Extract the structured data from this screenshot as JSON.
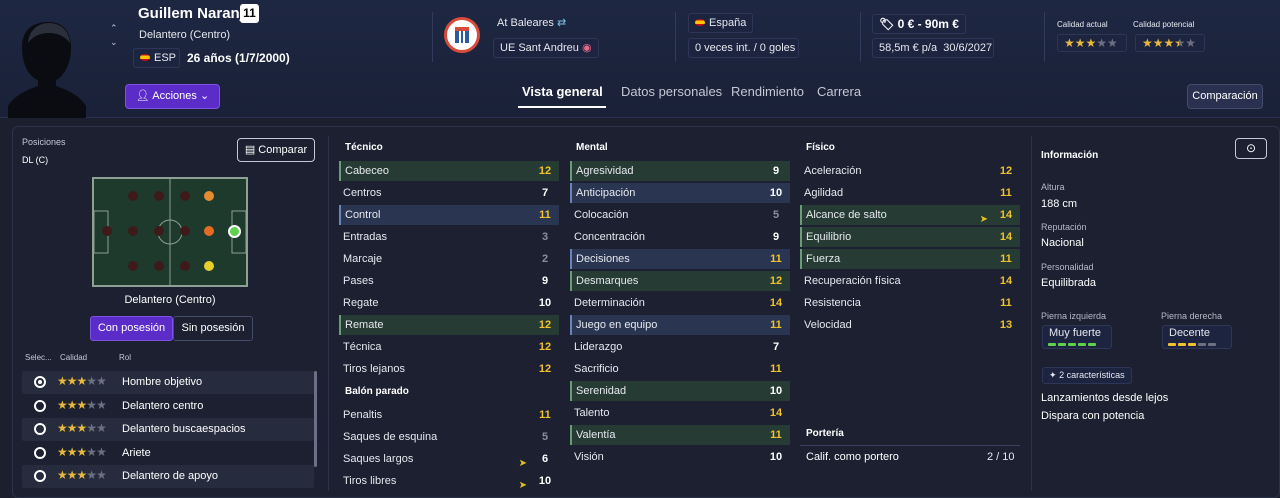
{
  "player": {
    "name": "Guillem Naranjo",
    "number": "11",
    "position": "Delantero (Centro)",
    "nation_code": "ESP",
    "age": "26 años (1/7/2000)"
  },
  "header": {
    "actions_label": "Acciones",
    "club_loan": "At Baleares",
    "club_own": "UE Sant Andreu",
    "nation": "España",
    "intl": "0 veces int. / 0 goles",
    "value": "0 € - 90m €",
    "contract": "58,5m € p/a",
    "contract_date": "30/6/2027",
    "current_quality_label": "Calidad actual",
    "potential_quality_label": "Calidad potencial",
    "current_stars": 3,
    "potential_stars": 3.5
  },
  "tabs": [
    "Vista general",
    "Datos personales",
    "Rendimiento",
    "Carrera"
  ],
  "compare_label": "Comparación",
  "left": {
    "positions_label": "Posiciones",
    "positions_value": "DL (C)",
    "compare_btn": "Comparar",
    "pitch_label": "Delantero (Centro)",
    "toggle_on": "Con posesión",
    "toggle_off": "Sin posesión",
    "cols": [
      "Selec...",
      "Calidad",
      "Rol"
    ],
    "roles": [
      {
        "name": "Hombre objetivo",
        "stars": 3,
        "selected": true
      },
      {
        "name": "Delantero centro",
        "stars": 3,
        "selected": false
      },
      {
        "name": "Delantero buscaespacios",
        "stars": 3,
        "selected": false
      },
      {
        "name": "Ariete",
        "stars": 3,
        "selected": false
      },
      {
        "name": "Delantero de apoyo",
        "stars": 3,
        "selected": false
      }
    ]
  },
  "tecnico": {
    "title": "Técnico",
    "attrs": [
      {
        "n": "Cabeceo",
        "v": "12",
        "c": "y",
        "h": "g"
      },
      {
        "n": "Centros",
        "v": "7",
        "c": "w",
        "h": ""
      },
      {
        "n": "Control",
        "v": "11",
        "c": "y",
        "h": "b"
      },
      {
        "n": "Entradas",
        "v": "3",
        "c": "g",
        "h": ""
      },
      {
        "n": "Marcaje",
        "v": "2",
        "c": "g",
        "h": ""
      },
      {
        "n": "Pases",
        "v": "9",
        "c": "w",
        "h": ""
      },
      {
        "n": "Regate",
        "v": "10",
        "c": "w",
        "h": ""
      },
      {
        "n": "Remate",
        "v": "12",
        "c": "y",
        "h": "g"
      },
      {
        "n": "Técnica",
        "v": "12",
        "c": "y",
        "h": ""
      },
      {
        "n": "Tiros lejanos",
        "v": "12",
        "c": "y",
        "h": ""
      }
    ]
  },
  "balon": {
    "title": "Balón parado",
    "attrs": [
      {
        "n": "Penaltis",
        "v": "11",
        "c": "y",
        "h": ""
      },
      {
        "n": "Saques de esquina",
        "v": "5",
        "c": "g",
        "h": ""
      },
      {
        "n": "Saques largos",
        "v": "6",
        "c": "w",
        "h": "",
        "arrow": true
      },
      {
        "n": "Tiros libres",
        "v": "10",
        "c": "w",
        "h": "",
        "arrow": true
      }
    ]
  },
  "mental": {
    "title": "Mental",
    "attrs": [
      {
        "n": "Agresividad",
        "v": "9",
        "c": "w",
        "h": "g"
      },
      {
        "n": "Anticipación",
        "v": "10",
        "c": "w",
        "h": "b"
      },
      {
        "n": "Colocación",
        "v": "5",
        "c": "g",
        "h": ""
      },
      {
        "n": "Concentración",
        "v": "9",
        "c": "w",
        "h": ""
      },
      {
        "n": "Decisiones",
        "v": "11",
        "c": "y",
        "h": "b"
      },
      {
        "n": "Desmarques",
        "v": "12",
        "c": "y",
        "h": "g"
      },
      {
        "n": "Determinación",
        "v": "14",
        "c": "y",
        "h": ""
      },
      {
        "n": "Juego en equipo",
        "v": "11",
        "c": "y",
        "h": "b"
      },
      {
        "n": "Liderazgo",
        "v": "7",
        "c": "w",
        "h": ""
      },
      {
        "n": "Sacrificio",
        "v": "11",
        "c": "y",
        "h": ""
      },
      {
        "n": "Serenidad",
        "v": "10",
        "c": "w",
        "h": "g"
      },
      {
        "n": "Talento",
        "v": "14",
        "c": "y",
        "h": ""
      },
      {
        "n": "Valentía",
        "v": "11",
        "c": "y",
        "h": "g"
      },
      {
        "n": "Visión",
        "v": "10",
        "c": "w",
        "h": ""
      }
    ]
  },
  "fisico": {
    "title": "Físico",
    "attrs": [
      {
        "n": "Aceleración",
        "v": "12",
        "c": "y",
        "h": ""
      },
      {
        "n": "Agilidad",
        "v": "11",
        "c": "y",
        "h": ""
      },
      {
        "n": "Alcance de salto",
        "v": "14",
        "c": "y",
        "h": "g",
        "arrow": true
      },
      {
        "n": "Equilibrio",
        "v": "14",
        "c": "y",
        "h": "g"
      },
      {
        "n": "Fuerza",
        "v": "11",
        "c": "y",
        "h": "g"
      },
      {
        "n": "Recuperación física",
        "v": "14",
        "c": "y",
        "h": ""
      },
      {
        "n": "Resistencia",
        "v": "11",
        "c": "y",
        "h": ""
      },
      {
        "n": "Velocidad",
        "v": "13",
        "c": "y",
        "h": ""
      }
    ]
  },
  "porteria": {
    "title": "Portería",
    "label": "Calif. como portero",
    "value": "2 / 10"
  },
  "info": {
    "title": "Información",
    "altura_l": "Altura",
    "altura": "188 cm",
    "rep_l": "Reputación",
    "rep": "Nacional",
    "pers_l": "Personalidad",
    "pers": "Equilibrada",
    "pi_l": "Pierna izquierda",
    "pi": "Muy fuerte",
    "pd_l": "Pierna derecha",
    "pd": "Decente",
    "chars_count": "2 características",
    "chars": [
      "Lanzamientos desde lejos",
      "Dispara con potencia"
    ]
  }
}
